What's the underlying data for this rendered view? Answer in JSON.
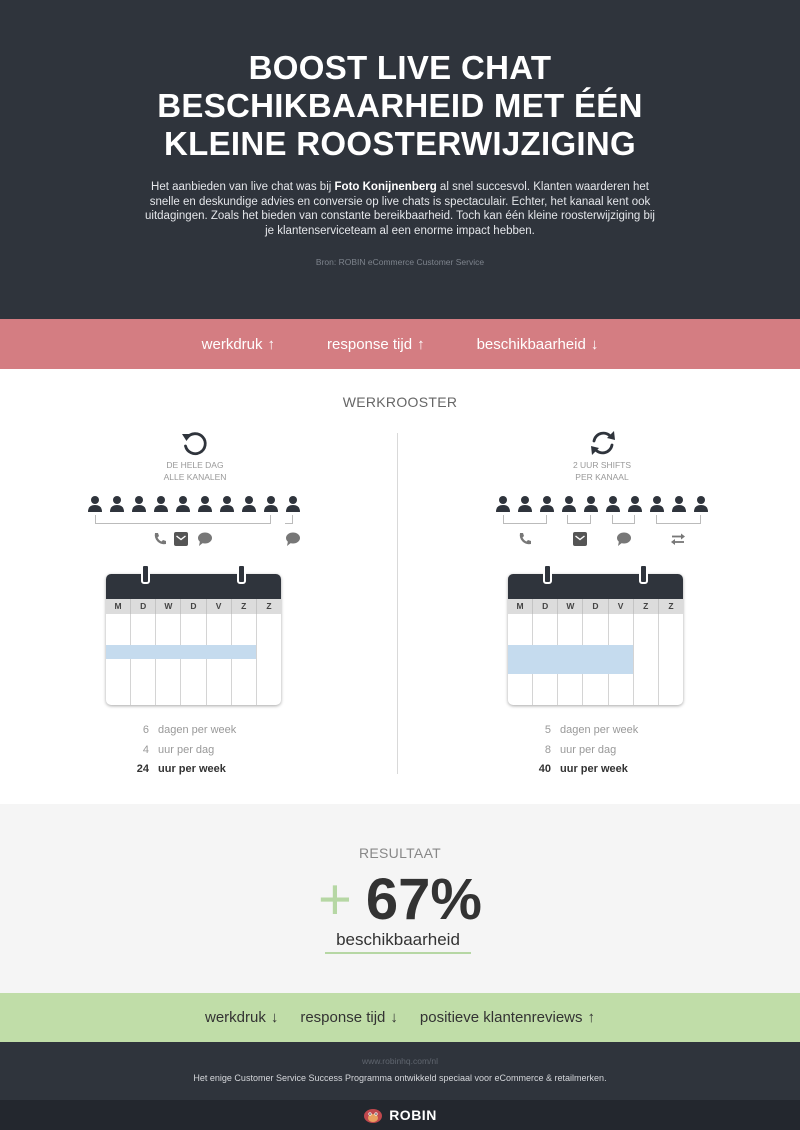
{
  "header": {
    "title_lines": [
      "BOOST LIVE CHAT",
      "BESCHIKBAARHEID MET ÉÉN",
      "KLEINE ROOSTERWIJZIGING"
    ],
    "intro_before": "Het aanbieden van live chat was bij ",
    "intro_bold": "Foto Konijnenberg",
    "intro_after": " al snel succesvol. Klanten waarderen het snelle en deskundige advies en conversie op live chats is spectaculair. Echter, het kanaal kent ook uitdagingen. Zoals het bieden van constante bereikbaarheid. Toch kan één kleine roosterwijziging bij je klantenserviceteam al een enorme impact hebben.",
    "source": "Bron: ROBIN eCommerce Customer Service"
  },
  "top_bar": {
    "items": [
      {
        "label": "werkdruk",
        "arrow": "↑"
      },
      {
        "label": "response tijd",
        "arrow": "↑"
      },
      {
        "label": "beschikbaarheid",
        "arrow": "↓"
      }
    ]
  },
  "schedule": {
    "title": "WERKROOSTER",
    "left": {
      "icon": "refresh-icon",
      "label_line1": "DE HELE DAG",
      "label_line2": "ALLE KANALEN",
      "days": [
        "M",
        "D",
        "W",
        "D",
        "V",
        "Z",
        "Z"
      ],
      "stats": [
        {
          "num": "6",
          "text": "dagen per week"
        },
        {
          "num": "4",
          "text": "uur per dag"
        },
        {
          "num": "24",
          "text": "uur per week"
        }
      ]
    },
    "right": {
      "icon": "sync-icon",
      "label_line1": "2 UUR SHIFTS",
      "label_line2": "PER KANAAL",
      "days": [
        "M",
        "D",
        "W",
        "D",
        "V",
        "Z",
        "Z"
      ],
      "stats": [
        {
          "num": "5",
          "text": "dagen per week"
        },
        {
          "num": "8",
          "text": "uur per dag"
        },
        {
          "num": "40",
          "text": "uur per week"
        }
      ]
    }
  },
  "result": {
    "label": "RESULTAAT",
    "plus": "+",
    "value": "67%",
    "subject": "beschikbaarheid"
  },
  "bottom_bar": {
    "items": [
      {
        "label": "werkdruk",
        "arrow": "↓"
      },
      {
        "label": "response tijd",
        "arrow": "↓"
      },
      {
        "label": "positieve klantenreviews",
        "arrow": "↑"
      }
    ]
  },
  "footer": {
    "url": "www.robinhq.com/nl",
    "tagline": "Het enige Customer Service Success Programma ontwikkeld speciaal voor eCommerce & retailmerken.",
    "brand": "ROBIN"
  },
  "colors": {
    "dark": "#2f343c",
    "red_bar": "#d47d82",
    "green_bar": "#c0dda8",
    "calendar_band": "#c5dbee"
  }
}
